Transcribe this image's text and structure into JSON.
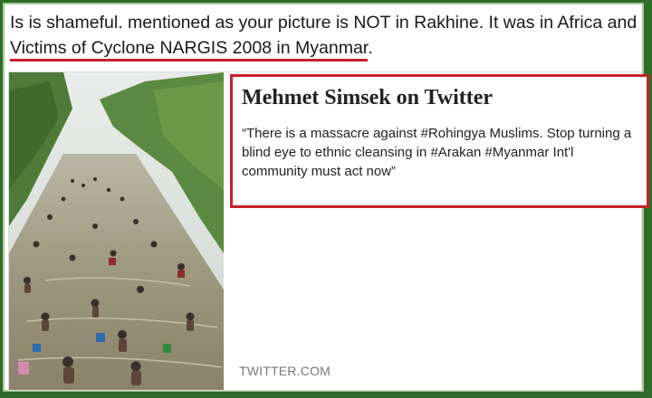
{
  "headline": {
    "prefix": "Is is shameful. mentioned as your picture is NOT in Rakhine. It was in Africa and ",
    "underlined": "Victims of Cyclone NARGIS 2008 in Myanmar",
    "suffix": "."
  },
  "card": {
    "title": "Mehmet Simsek on Twitter",
    "quote": "“There is a massacre against #Rohingya Muslims. Stop turning a blind eye to ethnic cleansing in #Arakan #Myanmar Int'l community must act now”",
    "source": "TWITTER.COM"
  },
  "colors": {
    "highlight_red": "#c8202a",
    "outer_frame": "#2f6b2a"
  }
}
